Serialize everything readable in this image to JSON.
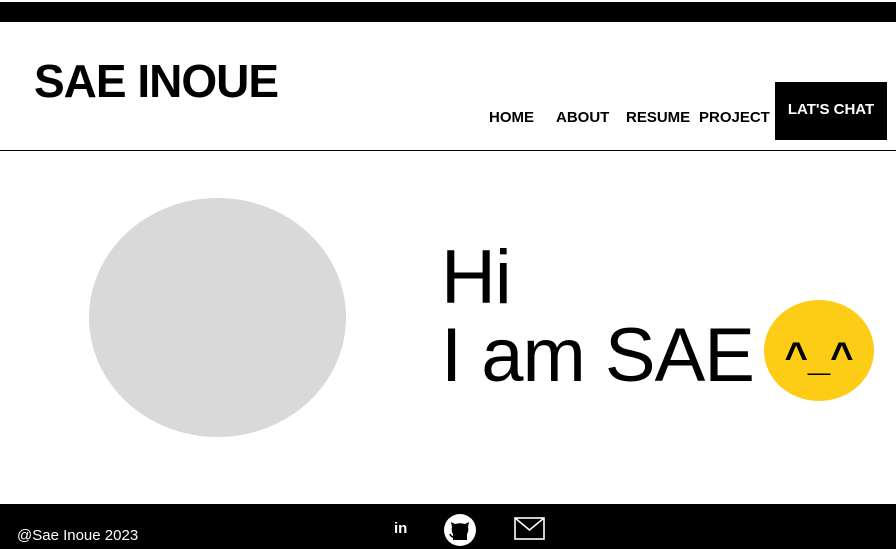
{
  "header": {
    "logo": "SAE INOUE",
    "nav": [
      {
        "label": "HOME"
      },
      {
        "label": "ABOUT"
      },
      {
        "label": "RESUME"
      },
      {
        "label": "PROJECT"
      }
    ],
    "cta_label": "LAT'S CHAT"
  },
  "hero": {
    "line1": "Hi",
    "line2": "I am SAE",
    "emoticon": "^_^",
    "emoticon_bg": "#fccc16",
    "avatar_bg": "#d9d9d9"
  },
  "footer": {
    "copyright": "@Sae Inoue 2023",
    "linkedin_text": "in",
    "icons": [
      "linkedin-icon",
      "github-icon",
      "mail-icon"
    ]
  }
}
